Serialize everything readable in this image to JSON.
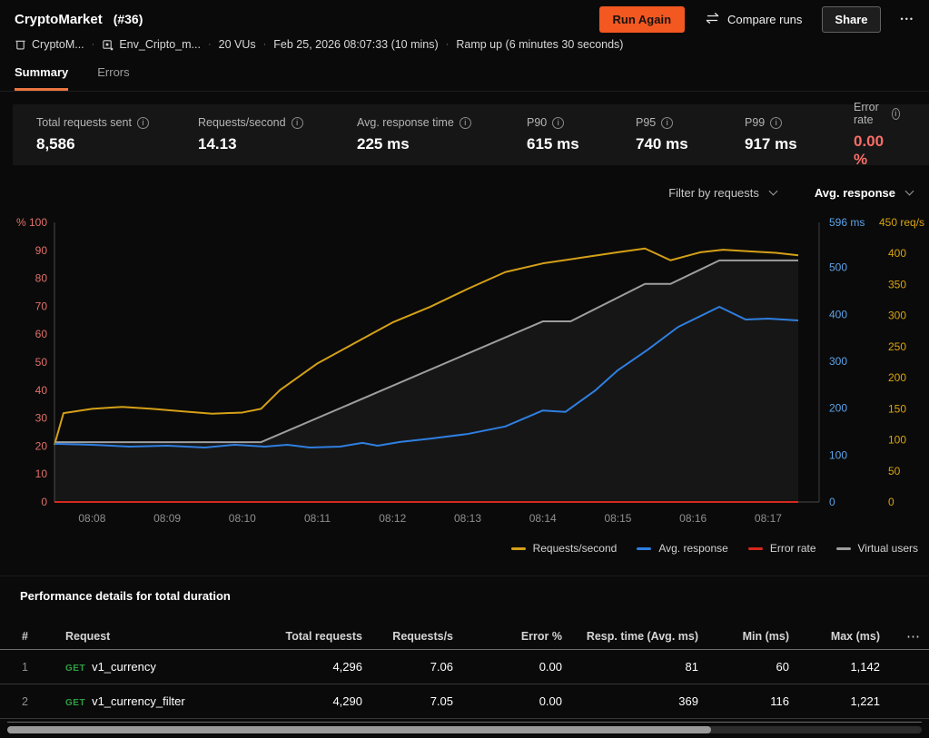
{
  "header": {
    "title": "CryptoMarket",
    "run_id": "(#36)",
    "buttons": {
      "run_again": "Run Again",
      "compare_runs": "Compare runs",
      "share": "Share"
    },
    "meta": {
      "project": "CryptoM...",
      "environment": "Env_Cripto_m...",
      "vus": "20 VUs",
      "started": "Feb 25, 2026 08:07:33 (10 mins)",
      "ramp": "Ramp up (6 minutes 30 seconds)"
    },
    "tabs": [
      {
        "label": "Summary",
        "active": true
      },
      {
        "label": "Errors",
        "active": false
      }
    ]
  },
  "stats": [
    {
      "label": "Total requests sent",
      "value": "8,586"
    },
    {
      "label": "Requests/second",
      "value": "14.13"
    },
    {
      "label": "Avg. response time",
      "value": "225 ms"
    },
    {
      "label": "P90",
      "value": "615 ms"
    },
    {
      "label": "P95",
      "value": "740 ms"
    },
    {
      "label": "P99",
      "value": "917 ms"
    },
    {
      "label": "Error rate",
      "value": "0.00 %",
      "value_color": "#fb6d66"
    }
  ],
  "chart_controls": {
    "filter_label": "Filter by requests",
    "metric_label": "Avg. response"
  },
  "chart_data": {
    "type": "line",
    "x_unit": "time (hh:mm), minutes offset from 08:07:30",
    "x_range_minutes": [
      0,
      9.9
    ],
    "x_ticks": [
      {
        "t": 0.5,
        "label": "08:08"
      },
      {
        "t": 1.5,
        "label": "08:09"
      },
      {
        "t": 2.5,
        "label": "08:10"
      },
      {
        "t": 3.5,
        "label": "08:11"
      },
      {
        "t": 4.5,
        "label": "08:12"
      },
      {
        "t": 5.5,
        "label": "08:13"
      },
      {
        "t": 6.5,
        "label": "08:14"
      },
      {
        "t": 7.5,
        "label": "08:15"
      },
      {
        "t": 8.5,
        "label": "08:16"
      },
      {
        "t": 9.5,
        "label": "08:17"
      }
    ],
    "left_axis": {
      "unit": "%",
      "color": "#e2706a",
      "max": 100,
      "ticks": [
        {
          "v": 100,
          "label": "% 100"
        },
        {
          "v": 90,
          "label": "90"
        },
        {
          "v": 80,
          "label": "80"
        },
        {
          "v": 70,
          "label": "70"
        },
        {
          "v": 60,
          "label": "60"
        },
        {
          "v": 50,
          "label": "50"
        },
        {
          "v": 40,
          "label": "40"
        },
        {
          "v": 30,
          "label": "30"
        },
        {
          "v": 20,
          "label": "20"
        },
        {
          "v": 10,
          "label": "10"
        },
        {
          "v": 0,
          "label": "0"
        }
      ]
    },
    "right_axis_response": {
      "top_label": "596 ms",
      "max": 596,
      "color": "#5da2e8",
      "ticks": [
        500,
        400,
        300,
        200,
        100,
        0
      ]
    },
    "right_axis_requests": {
      "top_label": "450 req/s",
      "max": 450,
      "color": "#d9a40e",
      "ticks": [
        400,
        350,
        300,
        250,
        200,
        150,
        100,
        50,
        0
      ]
    },
    "grid": false,
    "legend_position": "bottom-right",
    "series": [
      {
        "name": "Requests/second",
        "color": "#d4a017",
        "axis_max": 450,
        "points": [
          [
            0,
            92
          ],
          [
            0.12,
            143
          ],
          [
            0.5,
            150
          ],
          [
            0.9,
            153
          ],
          [
            1.3,
            150
          ],
          [
            1.7,
            146
          ],
          [
            2.1,
            142
          ],
          [
            2.5,
            144
          ],
          [
            2.75,
            150
          ],
          [
            3.0,
            180
          ],
          [
            3.5,
            223
          ],
          [
            4.0,
            256
          ],
          [
            4.5,
            289
          ],
          [
            5.0,
            314
          ],
          [
            5.5,
            343
          ],
          [
            6.0,
            370
          ],
          [
            6.5,
            384
          ],
          [
            7.0,
            393
          ],
          [
            7.5,
            402
          ],
          [
            7.86,
            408
          ],
          [
            8.2,
            389
          ],
          [
            8.6,
            402
          ],
          [
            8.9,
            406
          ],
          [
            9.3,
            403
          ],
          [
            9.6,
            401
          ],
          [
            9.9,
            397
          ]
        ]
      },
      {
        "name": "Avg. response",
        "color": "#2f7fe0",
        "axis_max": 596,
        "points": [
          [
            0,
            124
          ],
          [
            0.5,
            122
          ],
          [
            1.0,
            118
          ],
          [
            1.5,
            120
          ],
          [
            2.0,
            116
          ],
          [
            2.4,
            122
          ],
          [
            2.8,
            118
          ],
          [
            3.1,
            122
          ],
          [
            3.4,
            116
          ],
          [
            3.8,
            118
          ],
          [
            4.1,
            126
          ],
          [
            4.3,
            120
          ],
          [
            4.6,
            128
          ],
          [
            5.0,
            135
          ],
          [
            5.5,
            145
          ],
          [
            6.0,
            161
          ],
          [
            6.5,
            195
          ],
          [
            6.8,
            192
          ],
          [
            7.2,
            238
          ],
          [
            7.5,
            281
          ],
          [
            7.9,
            325
          ],
          [
            8.3,
            373
          ],
          [
            8.85,
            416
          ],
          [
            9.2,
            389
          ],
          [
            9.5,
            391
          ],
          [
            9.9,
            387
          ]
        ]
      },
      {
        "name": "Error rate",
        "color": "#d6281c",
        "axis_max": 100,
        "points": [
          [
            0,
            0
          ],
          [
            9.9,
            0
          ]
        ]
      },
      {
        "name": "Virtual users",
        "color": "#9e9e9e",
        "axis_max": 100,
        "area_fill": "rgba(255,255,255,0.05)",
        "points": [
          [
            0,
            21.4
          ],
          [
            2.75,
            21.4
          ],
          [
            6.5,
            64.6
          ],
          [
            6.87,
            64.6
          ],
          [
            7.86,
            78
          ],
          [
            8.2,
            78
          ],
          [
            8.85,
            86.4
          ],
          [
            9.9,
            86.4
          ]
        ]
      }
    ]
  },
  "table": {
    "title": "Performance details for total duration",
    "columns": [
      "#",
      "Request",
      "Total requests",
      "Requests/s",
      "Error %",
      "Resp. time (Avg. ms)",
      "Min (ms)",
      "Max (ms)"
    ],
    "rows": [
      {
        "num": "1",
        "method": "GET",
        "name": "v1_currency",
        "total": "4,296",
        "rps": "7.06",
        "error": "0.00",
        "avg": "81",
        "min": "60",
        "max": "1,142"
      },
      {
        "num": "2",
        "method": "GET",
        "name": "v1_currency_filter",
        "total": "4,290",
        "rps": "7.05",
        "error": "0.00",
        "avg": "369",
        "min": "116",
        "max": "1,221"
      }
    ]
  },
  "icons": {
    "info": "i",
    "kebab": "•••",
    "table_menu": "⋯"
  },
  "colors": {
    "accent_orange": "#f25820",
    "get_method": "#2ea043",
    "error_text": "#fb6d66",
    "stats_bg": "#161616"
  }
}
